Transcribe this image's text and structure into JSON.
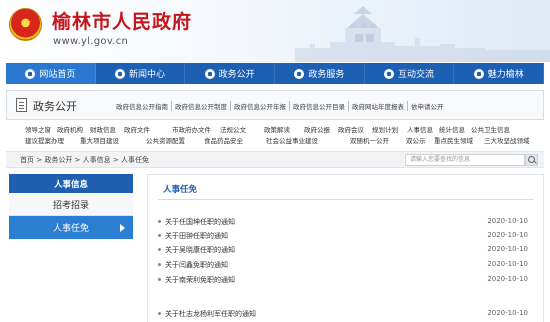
{
  "header": {
    "title": "榆林市人民政府",
    "url": "www.yl.gov.cn"
  },
  "nav": [
    {
      "label": "网站首页",
      "active": true
    },
    {
      "label": "新闻中心"
    },
    {
      "label": "政务公开"
    },
    {
      "label": "政务服务"
    },
    {
      "label": "互动交流"
    },
    {
      "label": "魅力榆林"
    }
  ],
  "section": {
    "title": "政务公开",
    "links": [
      "政府信息公开指南",
      "政府信息公开制度",
      "政府信息公开年报",
      "政府信息公开目录",
      "政府网站年度报表",
      "依申请公开"
    ]
  },
  "categories_row1": [
    "领导之窗",
    "政府机构",
    "财政信息",
    "政府文件",
    "市政府办文件",
    "法规公文",
    "政策解读",
    "政府公报",
    "政府会议",
    "规划计划",
    "人事信息",
    "统计信息",
    "公共卫生信息"
  ],
  "categories_row2": [
    "建议提案办理",
    "重大项目建设",
    "公共资源配置",
    "食品药品安全",
    "社会公益事业建设",
    "双随机一公开",
    "双公示",
    "重点民生领域",
    "三大攻坚战领域"
  ],
  "breadcrumb": "首页 > 政务公开 > 人事信息 > 人事任免",
  "search": {
    "placeholder": "请输入您要查找的信息"
  },
  "sidebar": {
    "header": "人事信息",
    "items": [
      {
        "label": "招考招录"
      },
      {
        "label": "人事任免",
        "active": true
      }
    ]
  },
  "main": {
    "title": "人事任免",
    "articles": [
      {
        "title": "关于任国坤任职的通知",
        "date": "2020-10-10"
      },
      {
        "title": "关于田翀任职的通知",
        "date": "2020-10-10"
      },
      {
        "title": "关于吴晓康任职的通知",
        "date": "2020-10-10"
      },
      {
        "title": "关于闫鑫免职的通知",
        "date": "2020-10-10"
      },
      {
        "title": "关于南荣利免职的通知",
        "date": "2020-10-10"
      },
      {
        "title": "关于杜志龙杨利军任职的通知",
        "date": "2020-10-10"
      }
    ]
  }
}
